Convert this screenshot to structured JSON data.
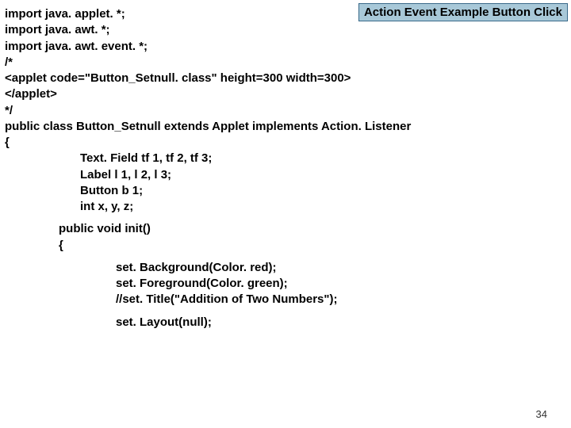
{
  "title": "Action Event Example Button Click",
  "lines": {
    "l1": "import java. applet. *;",
    "l2": "import java. awt. *;",
    "l3": "import java. awt. event. *;",
    "l4": "/*",
    "l5": "<applet code=\"Button_Setnull. class\" height=300 width=300>",
    "l6": "</applet>",
    "l7": "*/",
    "l8": "public class Button_Setnull extends Applet implements Action. Listener",
    "l9": "{",
    "l10": "Text. Field tf 1, tf 2, tf 3;",
    "l11": "Label l 1, l 2, l 3;",
    "l12": "Button b 1;",
    "l13": "int x, y, z;",
    "l14": "public void init()",
    "l15": "{",
    "l16": "set. Background(Color. red);",
    "l17": "set. Foreground(Color. green);",
    "l18": "//set. Title(\"Addition of Two Numbers\");",
    "l19": "set. Layout(null);"
  },
  "pageNumber": "34"
}
